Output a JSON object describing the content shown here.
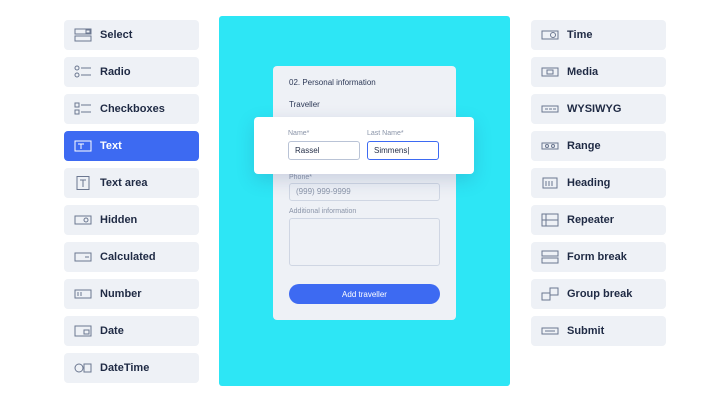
{
  "left_fields": [
    {
      "label": "Select",
      "icon": "select-icon"
    },
    {
      "label": "Radio",
      "icon": "radio-icon"
    },
    {
      "label": "Checkboxes",
      "icon": "checkboxes-icon"
    },
    {
      "label": "Text",
      "icon": "text-icon",
      "active": true
    },
    {
      "label": "Text area",
      "icon": "text-area-icon"
    },
    {
      "label": "Hidden",
      "icon": "hidden-icon"
    },
    {
      "label": "Calculated",
      "icon": "calculated-icon"
    },
    {
      "label": "Number",
      "icon": "number-icon"
    },
    {
      "label": "Date",
      "icon": "date-icon"
    },
    {
      "label": "DateTime",
      "icon": "datetime-icon"
    }
  ],
  "right_fields": [
    {
      "label": "Time",
      "icon": "time-icon"
    },
    {
      "label": "Media",
      "icon": "media-icon"
    },
    {
      "label": "WYSIWYG",
      "icon": "wysiwyg-icon"
    },
    {
      "label": "Range",
      "icon": "range-icon"
    },
    {
      "label": "Heading",
      "icon": "heading-icon"
    },
    {
      "label": "Repeater",
      "icon": "repeater-icon"
    },
    {
      "label": "Form break",
      "icon": "form-break-icon"
    },
    {
      "label": "Group break",
      "icon": "group-break-icon"
    },
    {
      "label": "Submit",
      "icon": "submit-icon"
    }
  ],
  "colors": {
    "accent": "#3d6af2",
    "stage": "#2de6f5",
    "tile": "#eef1f6"
  },
  "form": {
    "title": "02. Personal information",
    "section": "Traveller",
    "name_label": "Name*",
    "name_value": "Rassel",
    "last_name_label": "Last Name*",
    "last_name_value": "Simmens|",
    "phone_label": "Phone*",
    "phone_placeholder": "(999) 999-9999",
    "additional_label": "Additional information",
    "add_button": "Add traveller"
  }
}
